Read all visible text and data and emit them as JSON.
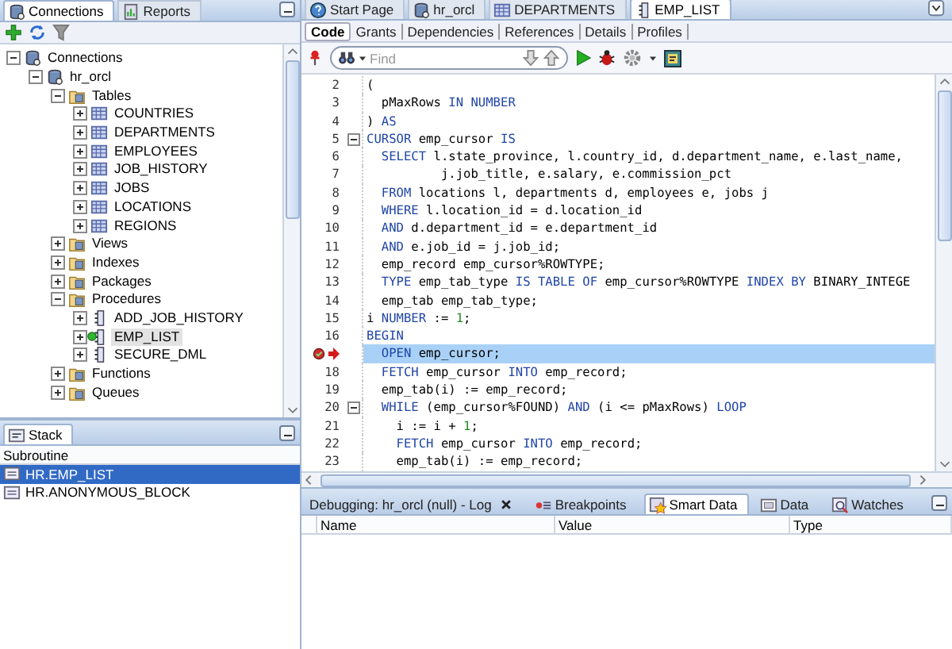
{
  "connections_panel": {
    "tabs": [
      {
        "label": "Connections",
        "kind": "connection",
        "selected": true
      },
      {
        "label": "Reports",
        "kind": "report",
        "selected": false
      }
    ],
    "tree": [
      {
        "label": "Connections",
        "kind": "connection",
        "expanded": true,
        "selected": false,
        "children": [
          {
            "label": "hr_orcl",
            "kind": "connection",
            "expanded": true,
            "selected": false,
            "children": [
              {
                "label": "Tables",
                "kind": "folder",
                "expanded": true,
                "selected": false,
                "children": [
                  {
                    "label": "COUNTRIES",
                    "kind": "table",
                    "expanded": false,
                    "selected": false
                  },
                  {
                    "label": "DEPARTMENTS",
                    "kind": "table",
                    "expanded": false,
                    "selected": false
                  },
                  {
                    "label": "EMPLOYEES",
                    "kind": "table",
                    "expanded": false,
                    "selected": false
                  },
                  {
                    "label": "JOB_HISTORY",
                    "kind": "table",
                    "expanded": false,
                    "selected": false
                  },
                  {
                    "label": "JOBS",
                    "kind": "table",
                    "expanded": false,
                    "selected": false
                  },
                  {
                    "label": "LOCATIONS",
                    "kind": "table",
                    "expanded": false,
                    "selected": false
                  },
                  {
                    "label": "REGIONS",
                    "kind": "table",
                    "expanded": false,
                    "selected": false
                  }
                ]
              },
              {
                "label": "Views",
                "kind": "folder",
                "expanded": false,
                "selected": false
              },
              {
                "label": "Indexes",
                "kind": "folder",
                "expanded": false,
                "selected": false
              },
              {
                "label": "Packages",
                "kind": "folder",
                "expanded": false,
                "selected": false
              },
              {
                "label": "Procedures",
                "kind": "folder",
                "expanded": true,
                "selected": false,
                "children": [
                  {
                    "label": "ADD_JOB_HISTORY",
                    "kind": "procedure",
                    "expanded": false,
                    "selected": false,
                    "debugging": false
                  },
                  {
                    "label": "EMP_LIST",
                    "kind": "procedure",
                    "expanded": false,
                    "selected": true,
                    "debugging": true
                  },
                  {
                    "label": "SECURE_DML",
                    "kind": "procedure",
                    "expanded": false,
                    "selected": false,
                    "debugging": false
                  }
                ]
              },
              {
                "label": "Functions",
                "kind": "folder",
                "expanded": false,
                "selected": false
              },
              {
                "label": "Queues",
                "kind": "folder",
                "expanded": false,
                "selected": false
              }
            ]
          }
        ]
      }
    ]
  },
  "stack_panel": {
    "tabs": [
      {
        "label": "Stack",
        "selected": true
      }
    ],
    "column": "Subroutine",
    "rows": [
      {
        "label": "HR.EMP_LIST",
        "selected": true
      },
      {
        "label": "HR.ANONYMOUS_BLOCK",
        "selected": false
      }
    ]
  },
  "editor": {
    "tabs": [
      {
        "label": "Start Page",
        "kind": "help",
        "selected": false
      },
      {
        "label": "hr_orcl",
        "kind": "connection",
        "selected": false
      },
      {
        "label": "DEPARTMENTS",
        "kind": "table",
        "selected": false
      },
      {
        "label": "EMP_LIST",
        "kind": "procedure",
        "selected": true
      }
    ],
    "subtabs": [
      {
        "label": "Code",
        "selected": true
      },
      {
        "label": "Grants",
        "selected": false
      },
      {
        "label": "Dependencies",
        "selected": false
      },
      {
        "label": "References",
        "selected": false
      },
      {
        "label": "Details",
        "selected": false
      },
      {
        "label": "Profiles",
        "selected": false
      }
    ],
    "find": {
      "placeholder": "Find"
    },
    "lines": [
      {
        "number": "2",
        "fold": false,
        "segments": [
          {
            "text": "(",
            "kind": "plain"
          }
        ]
      },
      {
        "number": "3",
        "fold": false,
        "segments": [
          {
            "text": "  pMaxRows ",
            "kind": "plain"
          },
          {
            "text": "IN NUMBER",
            "kind": "keyword"
          }
        ]
      },
      {
        "number": "4",
        "fold": false,
        "segments": [
          {
            "text": ") ",
            "kind": "plain"
          },
          {
            "text": "AS",
            "kind": "keyword"
          }
        ]
      },
      {
        "number": "5",
        "fold": true,
        "segments": [
          {
            "text": "CURSOR",
            "kind": "keyword"
          },
          {
            "text": " emp_cursor ",
            "kind": "plain"
          },
          {
            "text": "IS",
            "kind": "keyword"
          }
        ]
      },
      {
        "number": "6",
        "fold": false,
        "segments": [
          {
            "text": "  SELECT",
            "kind": "keyword"
          },
          {
            "text": " l.state_province, l.country_id, d.department_name, e.last_name,",
            "kind": "plain"
          }
        ]
      },
      {
        "number": "7",
        "fold": false,
        "segments": [
          {
            "text": "          j.job_title, e.salary, e.commission_pct",
            "kind": "plain"
          }
        ]
      },
      {
        "number": "8",
        "fold": false,
        "segments": [
          {
            "text": "  FROM",
            "kind": "keyword"
          },
          {
            "text": " locations l, departments d, employees e, jobs j",
            "kind": "plain"
          }
        ]
      },
      {
        "number": "9",
        "fold": false,
        "segments": [
          {
            "text": "  WHERE",
            "kind": "keyword"
          },
          {
            "text": " l.location_id = d.location_id",
            "kind": "plain"
          }
        ]
      },
      {
        "number": "10",
        "fold": false,
        "segments": [
          {
            "text": "  AND",
            "kind": "keyword"
          },
          {
            "text": " d.department_id = e.department_id",
            "kind": "plain"
          }
        ]
      },
      {
        "number": "11",
        "fold": false,
        "segments": [
          {
            "text": "  AND",
            "kind": "keyword"
          },
          {
            "text": " e.job_id = j.job_id;",
            "kind": "plain"
          }
        ]
      },
      {
        "number": "12",
        "fold": false,
        "segments": [
          {
            "text": "  emp_record emp_cursor%ROWTYPE;",
            "kind": "plain"
          }
        ]
      },
      {
        "number": "13",
        "fold": false,
        "segments": [
          {
            "text": "  TYPE",
            "kind": "keyword"
          },
          {
            "text": " emp_tab_type ",
            "kind": "plain"
          },
          {
            "text": "IS TABLE OF",
            "kind": "keyword"
          },
          {
            "text": " emp_cursor%ROWTYPE ",
            "kind": "plain"
          },
          {
            "text": "INDEX BY",
            "kind": "keyword"
          },
          {
            "text": " BINARY_INTEGE",
            "kind": "plain"
          }
        ]
      },
      {
        "number": "14",
        "fold": false,
        "segments": [
          {
            "text": "  emp_tab emp_tab_type;",
            "kind": "plain"
          }
        ]
      },
      {
        "number": "15",
        "fold": false,
        "segments": [
          {
            "text": "i ",
            "kind": "plain"
          },
          {
            "text": "NUMBER",
            "kind": "keyword"
          },
          {
            "text": " := ",
            "kind": "plain"
          },
          {
            "text": "1",
            "kind": "number"
          },
          {
            "text": ";",
            "kind": "plain"
          }
        ]
      },
      {
        "number": "16",
        "fold": false,
        "segments": [
          {
            "text": "BEGIN",
            "kind": "keyword"
          }
        ]
      },
      {
        "breakpoint": true,
        "current": true,
        "fold": false,
        "segments": [
          {
            "text": "  OPEN",
            "kind": "keyword"
          },
          {
            "text": " emp_cursor;",
            "kind": "plain"
          }
        ]
      },
      {
        "number": "18",
        "fold": false,
        "segments": [
          {
            "text": "  FETCH",
            "kind": "keyword"
          },
          {
            "text": " emp_cursor ",
            "kind": "plain"
          },
          {
            "text": "INTO",
            "kind": "keyword"
          },
          {
            "text": " emp_record;",
            "kind": "plain"
          }
        ]
      },
      {
        "number": "19",
        "fold": false,
        "segments": [
          {
            "text": "  emp_tab(i) := emp_record;",
            "kind": "plain"
          }
        ]
      },
      {
        "number": "20",
        "fold": true,
        "segments": [
          {
            "text": "  WHILE",
            "kind": "keyword"
          },
          {
            "text": " (emp_cursor%FOUND) ",
            "kind": "plain"
          },
          {
            "text": "AND",
            "kind": "keyword"
          },
          {
            "text": " (i <= pMaxRows) ",
            "kind": "plain"
          },
          {
            "text": "LOOP",
            "kind": "keyword"
          }
        ]
      },
      {
        "number": "21",
        "fold": false,
        "segments": [
          {
            "text": "    i := i + ",
            "kind": "plain"
          },
          {
            "text": "1",
            "kind": "number"
          },
          {
            "text": ";",
            "kind": "plain"
          }
        ]
      },
      {
        "number": "22",
        "fold": false,
        "segments": [
          {
            "text": "    FETCH",
            "kind": "keyword"
          },
          {
            "text": " emp_cursor ",
            "kind": "plain"
          },
          {
            "text": "INTO",
            "kind": "keyword"
          },
          {
            "text": " emp_record;",
            "kind": "plain"
          }
        ]
      },
      {
        "number": "23",
        "fold": false,
        "segments": [
          {
            "text": "    emp_tab(i) := emp_record;",
            "kind": "plain"
          }
        ]
      }
    ]
  },
  "debug_panel": {
    "tabs": [
      {
        "label": "Debugging: hr_orcl (null) - Log",
        "kind": "log",
        "selected": false,
        "closable": true
      },
      {
        "label": "Breakpoints",
        "kind": "breakpoints",
        "selected": false,
        "closable": false
      },
      {
        "label": "Smart Data",
        "kind": "smart_data",
        "selected": true,
        "closable": false
      },
      {
        "label": "Data",
        "kind": "data",
        "selected": false,
        "closable": false
      },
      {
        "label": "Watches",
        "kind": "watches",
        "selected": false,
        "closable": false
      }
    ],
    "columns": [
      "Name",
      "Value",
      "Type"
    ]
  }
}
